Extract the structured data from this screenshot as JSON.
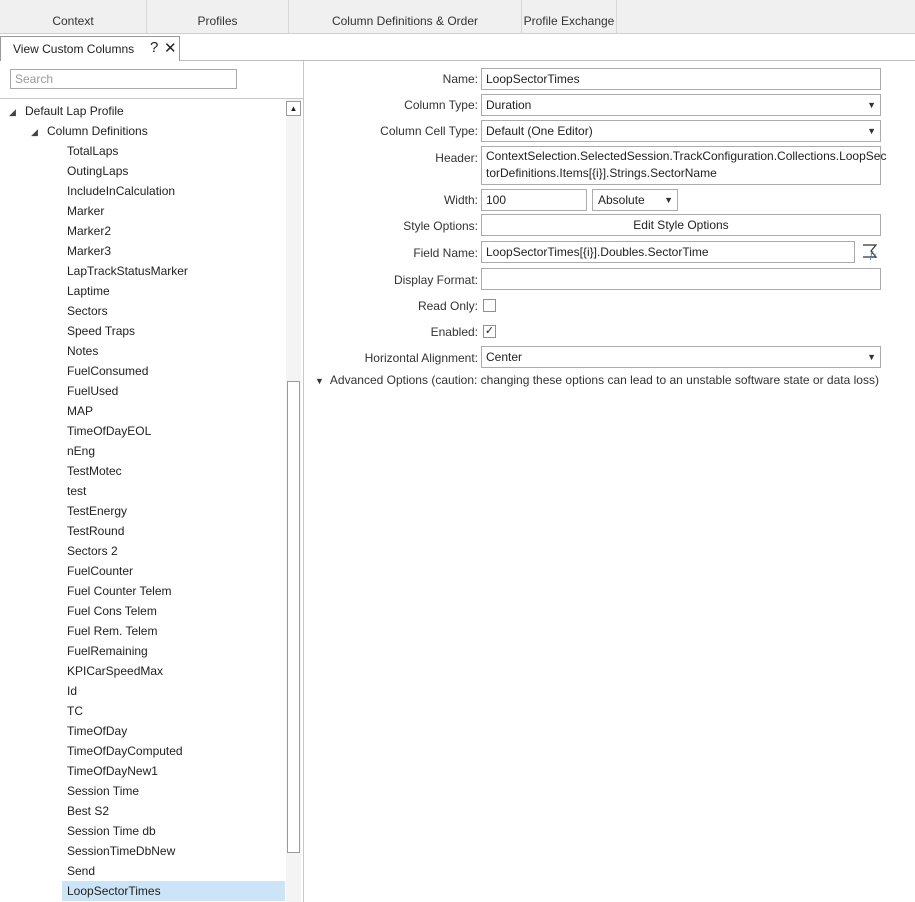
{
  "top_tabs": [
    "Context",
    "Profiles",
    "Column Definitions & Order",
    "Profile Exchange"
  ],
  "subtab": {
    "label": "View Custom Columns",
    "help": "?",
    "close": "✕"
  },
  "search": {
    "placeholder": "Search",
    "value": ""
  },
  "tree": {
    "root_label": "Default Lap Profile",
    "group_label": "Column Definitions",
    "items": [
      "TotalLaps",
      "OutingLaps",
      "IncludeInCalculation",
      "Marker",
      "Marker2",
      "Marker3",
      "LapTrackStatusMarker",
      "Laptime",
      "Sectors",
      "Speed Traps",
      "Notes",
      "FuelConsumed",
      "FuelUsed",
      "MAP",
      "TimeOfDayEOL",
      "nEng",
      "TestMotec",
      "test",
      "TestEnergy",
      "TestRound",
      "Sectors 2",
      "FuelCounter",
      "Fuel Counter Telem",
      "Fuel Cons Telem",
      "Fuel Rem. Telem",
      "FuelRemaining",
      "KPICarSpeedMax",
      "Id",
      "TC",
      "TimeOfDay",
      "TimeOfDayComputed",
      "TimeOfDayNew1",
      "Session Time",
      "Best S2",
      "Session Time db",
      "SessionTimeDbNew",
      "Send",
      "LoopSectorTimes"
    ],
    "selected": "LoopSectorTimes"
  },
  "form": {
    "name_label": "Name:",
    "name_value": "LoopSectorTimes",
    "column_type_label": "Column Type:",
    "column_type_value": "Duration",
    "cell_type_label": "Column Cell Type:",
    "cell_type_value": "Default (One Editor)",
    "header_label": "Header:",
    "header_line1": "ContextSelection.SelectedSession.TrackConfiguration.Collections.LoopSec",
    "header_line2": "torDefinitions.Items[{i}].Strings.SectorName",
    "width_label": "Width:",
    "width_value": "100",
    "width_mode": "Absolute",
    "style_label": "Style Options:",
    "style_button": "Edit Style Options",
    "field_name_label": "Field Name:",
    "field_name_value": "LoopSectorTimes[{i}].Doubles.SectorTime",
    "display_format_label": "Display Format:",
    "display_format_value": "",
    "read_only_label": "Read Only:",
    "read_only_checked": false,
    "enabled_label": "Enabled:",
    "enabled_checked": true,
    "halign_label": "Horizontal Alignment:",
    "halign_value": "Center",
    "advanced_label": "Advanced Options (caution: changing these options can lead to an unstable software state or data loss)"
  },
  "icons": {
    "fx": "function-editor-icon",
    "expand": "triangle-down-icon"
  }
}
